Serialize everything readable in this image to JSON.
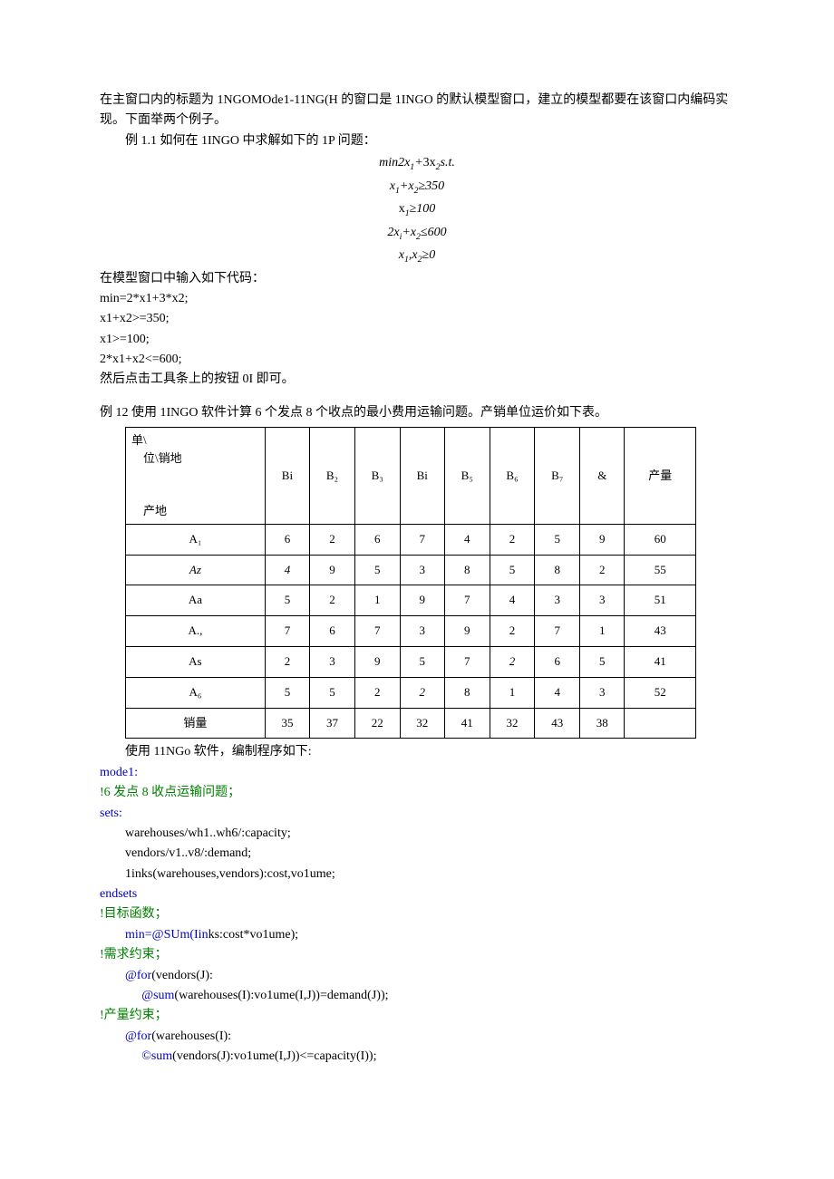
{
  "intro1": "在主窗口内的标题为 1NGOMOde1-11NG(H 的窗口是 1INGO 的默认模型窗口，建立的模型都要在该窗口内编码实现。下面举两个例子。",
  "intro2": "例 1.1 如何在 1INGO 中求解如下的 1P 问题：",
  "eq1": "min2x₁+3x₂s.t.",
  "eq2": "x₁+x₂≥350",
  "eq3": "x₁≥100",
  "eq4": "2xᵢ+x₂≤600",
  "eq5": "x₁,x₂≥0",
  "input_label": "在模型窗口中输入如下代码：",
  "code1": "min=2*x1+3*x2;",
  "code2": "x1+x2>=350;",
  "code3": "x1>=100;",
  "code4": "2*x1+x2<=600;",
  "after_code": "然后点击工具条上的按钮 0I 即可。",
  "example12": "例 12 使用 1INGO 软件计算 6 个发点 8 个收点的最小费用运输问题。产销单位运价如下表。",
  "corner": {
    "l1": "单\\",
    "l2": "　位\\销地",
    "l3": "",
    "l4": "",
    "l5": "　产地"
  },
  "cols": [
    "Bi",
    "B₂",
    "B₃",
    "Bi",
    "B₅",
    "B₆",
    "B₇",
    "&",
    "产量"
  ],
  "rows": [
    {
      "h": "A₁",
      "v": [
        "6",
        "2",
        "6",
        "7",
        "4",
        "2",
        "5",
        "9",
        "60"
      ]
    },
    {
      "h": "Az",
      "hi": true,
      "v": [
        "4",
        "9",
        "5",
        "3",
        "8",
        "5",
        "8",
        "2",
        "55"
      ],
      "vi0": true
    },
    {
      "h": "Aa",
      "v": [
        "5",
        "2",
        "1",
        "9",
        "7",
        "4",
        "3",
        "3",
        "51"
      ]
    },
    {
      "h": "A.,",
      "v": [
        "7",
        "6",
        "7",
        "3",
        "9",
        "2",
        "7",
        "1",
        "43"
      ]
    },
    {
      "h": "As",
      "v": [
        "2",
        "3",
        "9",
        "5",
        "7",
        "2",
        "6",
        "5",
        "41"
      ],
      "vi5": true
    },
    {
      "h": "A₆",
      "v": [
        "5",
        "5",
        "2",
        "2",
        "8",
        "1",
        "4",
        "3",
        "52"
      ],
      "vi3": true
    }
  ],
  "lastrow": {
    "h": "销量",
    "v": [
      "35",
      "37",
      "22",
      "32",
      "41",
      "32",
      "43",
      "38",
      ""
    ]
  },
  "after_table": "使用 11NGo 软件，编制程序如下:",
  "p_model": "mode1:",
  "p_comment1": "!6 发点 8 收点运输问题；",
  "p_sets": "sets:",
  "p_sets1": "warehouses/wh1..wh6/:capacity;",
  "p_sets2": "vendors/v1..v8/:demand;",
  "p_sets3": "1inks(warehouses,vendors):cost,vo1ume;",
  "p_endsets": "endsets",
  "p_obj_c": "!目标函数；",
  "p_obj_pre": "min=@SUm(Iin",
  "p_obj_suf": "ks:cost*vo1ume);",
  "p_dem_c": "!需求约束；",
  "p_for1": "@for",
  "p_for1_suf": "(vendors(J):",
  "p_sum1": "@sum",
  "p_sum1_suf": "(warehouses(I):vo1ume(I,J))=demand(J));",
  "p_cap_c": "!产量约束；",
  "p_for2": "@for",
  "p_for2_suf": "(warehouses(I):",
  "p_sum2": "©sum",
  "p_sum2_suf": "(vendors(J):vo1ume(I,J))<=capacity(I));"
}
